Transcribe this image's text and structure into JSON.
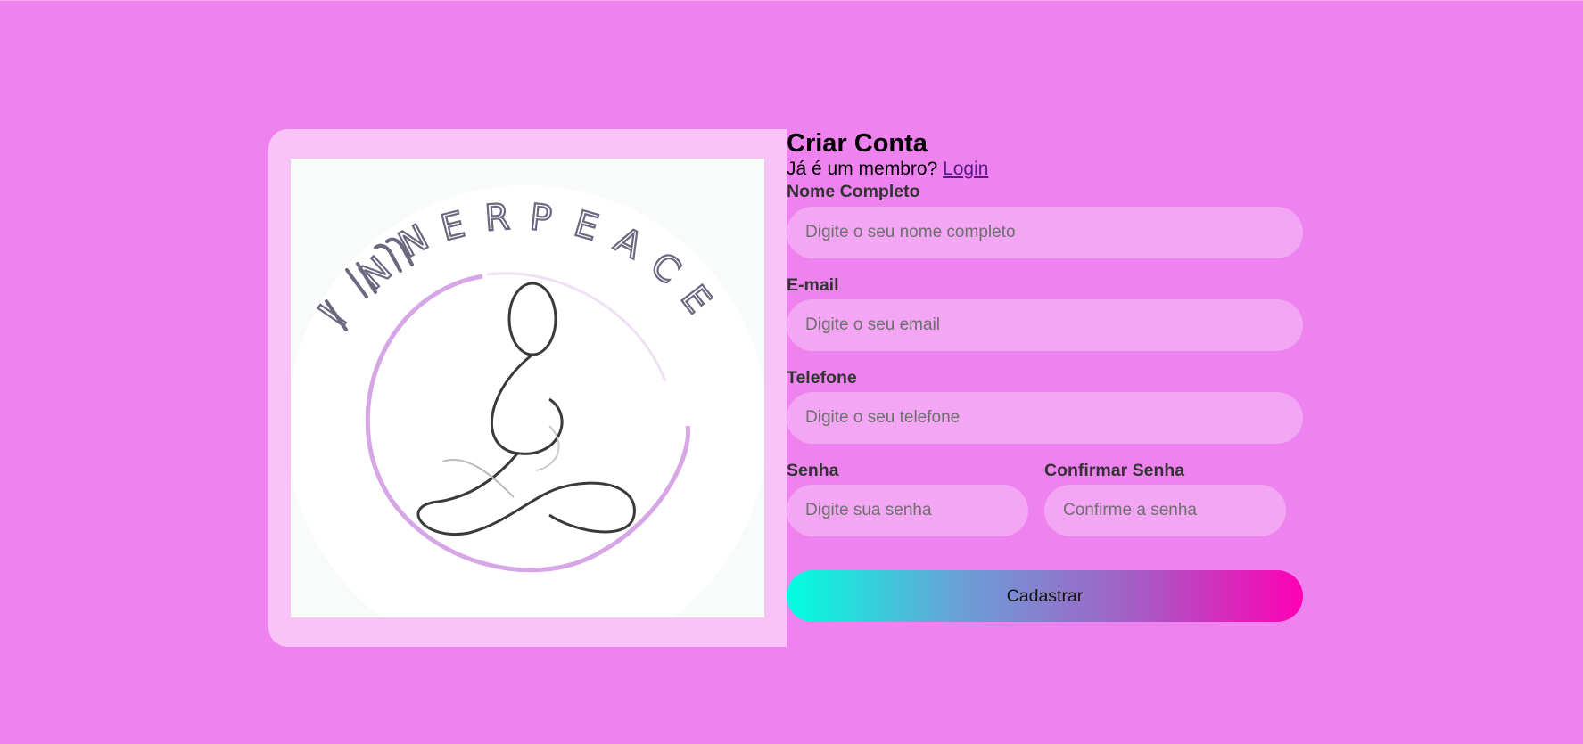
{
  "logo": {
    "text": "INNERPEACE",
    "alt": "InnerPeace logo"
  },
  "form": {
    "title": "Criar Conta",
    "member_prompt": "Já é um membro?",
    "login_link": "Login",
    "fields": {
      "name": {
        "label": "Nome Completo",
        "placeholder": "Digite o seu nome completo",
        "value": ""
      },
      "email": {
        "label": "E-mail",
        "placeholder": "Digite o seu email",
        "value": ""
      },
      "phone": {
        "label": "Telefone",
        "placeholder": "Digite o seu telefone",
        "value": ""
      },
      "password": {
        "label": "Senha",
        "placeholder": "Digite sua senha",
        "value": ""
      },
      "confirm_password": {
        "label": "Confirmar Senha",
        "placeholder": "Confirme a senha",
        "value": ""
      }
    },
    "submit_label": "Cadastrar"
  },
  "colors": {
    "background": "#ee82ee",
    "panel": "#f8c4f8",
    "input_bg": "#f3a6f3",
    "gradient_start": "#00ffdf",
    "gradient_end": "#ff00b4"
  }
}
